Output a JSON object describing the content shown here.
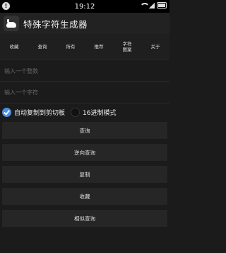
{
  "status_bar": {
    "time": "19:12",
    "left_icon": "notification-icon"
  },
  "app_bar": {
    "title": "特殊字符生成器",
    "logo": "cat-logo-icon"
  },
  "tabs": [
    {
      "label": "收藏"
    },
    {
      "label": "查询"
    },
    {
      "label": "所有"
    },
    {
      "label": "推荐"
    },
    {
      "label": "字符图案"
    },
    {
      "label": "关于"
    }
  ],
  "inputs": {
    "number_placeholder": "输入一个整数",
    "char_placeholder": "输入一个字符"
  },
  "options": {
    "auto_copy_label": "自动复制到剪切板",
    "auto_copy_checked": true,
    "hex_mode_label": "16进制模式",
    "hex_mode_checked": false
  },
  "buttons": {
    "query": "查询",
    "reverse_query": "逆向查询",
    "copy": "复制",
    "favorite": "收藏",
    "similar_query": "相似查询"
  },
  "colors": {
    "accent": "#4a90e2",
    "background": "#1b1b1b",
    "button": "#262626"
  }
}
